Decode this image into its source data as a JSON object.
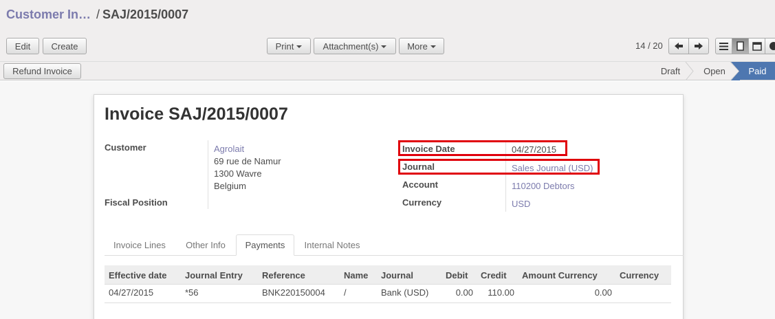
{
  "breadcrumb": {
    "parent": "Customer In…",
    "separator": "/",
    "current": "SAJ/2015/0007"
  },
  "toolbar": {
    "edit_label": "Edit",
    "create_label": "Create",
    "print_label": "Print",
    "attachments_label": "Attachment(s)",
    "more_label": "More",
    "pager": "14 / 20"
  },
  "statusbar": {
    "refund_label": "Refund Invoice",
    "stages": [
      "Draft",
      "Open",
      "Paid"
    ],
    "current_stage": "Paid"
  },
  "invoice": {
    "title_prefix": "Invoice",
    "number": "SAJ/2015/0007",
    "labels": {
      "customer": "Customer",
      "fiscal_position": "Fiscal Position",
      "invoice_date": "Invoice Date",
      "journal": "Journal",
      "account": "Account",
      "currency": "Currency"
    },
    "customer_name": "Agrolait",
    "address": [
      "69 rue de Namur",
      "1300 Wavre",
      "Belgium"
    ],
    "invoice_date": "04/27/2015",
    "journal": "Sales Journal (USD)",
    "account": "110200 Debtors",
    "currency": "USD"
  },
  "tabs": [
    "Invoice Lines",
    "Other Info",
    "Payments",
    "Internal Notes"
  ],
  "active_tab": "Payments",
  "payments": {
    "columns": [
      "Effective date",
      "Journal Entry",
      "Reference",
      "Name",
      "Journal",
      "Debit",
      "Credit",
      "Amount Currency",
      "Currency"
    ],
    "rows": [
      [
        "04/27/2015",
        "*56",
        "BNK220150004",
        "/",
        "Bank (USD)",
        "0.00",
        "110.00",
        "0.00",
        ""
      ]
    ]
  },
  "colors": {
    "link": "#7c7bad",
    "highlight": "#e0000b",
    "current_stage": "#4e77b0"
  }
}
